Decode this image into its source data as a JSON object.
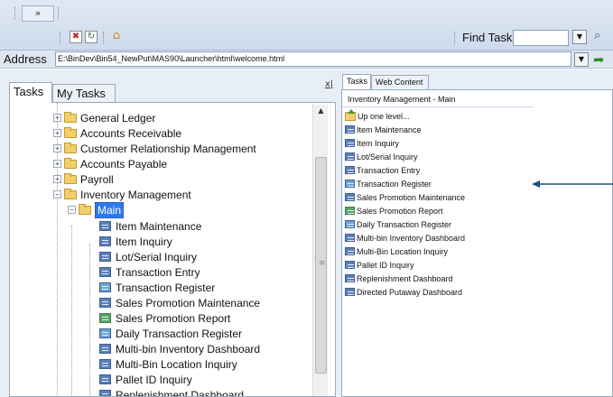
{
  "toolbar": {
    "chevron_label": "»",
    "find_task_label": "Find Task",
    "find_task_value": ""
  },
  "address": {
    "label": "Address",
    "url": "E:\\BinDev\\Bin54_NewPut\\MAS90\\Launcher\\html\\welcome.html"
  },
  "left_panel": {
    "tabs": [
      {
        "label": "Tasks"
      },
      {
        "label": "My Tasks"
      }
    ],
    "close_label": "x|",
    "tree": [
      {
        "label": "General Ledger",
        "kind": "folder",
        "expander": "+"
      },
      {
        "label": "Accounts Receivable",
        "kind": "folder",
        "expander": "+"
      },
      {
        "label": "Customer Relationship Management",
        "kind": "folder",
        "expander": "+"
      },
      {
        "label": "Accounts Payable",
        "kind": "folder",
        "expander": "+"
      },
      {
        "label": "Payroll",
        "kind": "folder",
        "expander": "+"
      },
      {
        "label": "Inventory Management",
        "kind": "folder",
        "expander": "−"
      },
      {
        "label": "Main",
        "kind": "folder-open",
        "expander": "−",
        "selected": true
      },
      {
        "label": "Item Maintenance",
        "kind": "task"
      },
      {
        "label": "Item Inquiry",
        "kind": "task"
      },
      {
        "label": "Lot/Serial Inquiry",
        "kind": "task"
      },
      {
        "label": "Transaction Entry",
        "kind": "task"
      },
      {
        "label": "Transaction Register",
        "kind": "report"
      },
      {
        "label": "Sales Promotion Maintenance",
        "kind": "task"
      },
      {
        "label": "Sales Promotion Report",
        "kind": "promo"
      },
      {
        "label": "Daily Transaction Register",
        "kind": "report"
      },
      {
        "label": "Multi-bin Inventory Dashboard",
        "kind": "task"
      },
      {
        "label": "Multi-Bin Location Inquiry",
        "kind": "task"
      },
      {
        "label": "Pallet ID Inquiry",
        "kind": "task"
      },
      {
        "label": "Replenishment Dashboard",
        "kind": "task"
      }
    ]
  },
  "right_panel": {
    "tabs": [
      {
        "label": "Tasks"
      },
      {
        "label": "Web Content"
      }
    ],
    "header": "Inventory Management - Main",
    "items": [
      {
        "label": "Up one level...",
        "kind": "up"
      },
      {
        "label": "Item Maintenance",
        "kind": "task"
      },
      {
        "label": "Item Inquiry",
        "kind": "task"
      },
      {
        "label": "Lot/Serial Inquiry",
        "kind": "task"
      },
      {
        "label": "Transaction Entry",
        "kind": "task"
      },
      {
        "label": "Transaction Register",
        "kind": "report"
      },
      {
        "label": "Sales Promotion Maintenance",
        "kind": "task"
      },
      {
        "label": "Sales Promotion Report",
        "kind": "promo"
      },
      {
        "label": "Daily Transaction Register",
        "kind": "report"
      },
      {
        "label": "Multi-bin Inventory Dashboard",
        "kind": "task"
      },
      {
        "label": "Multi-Bin Location Inquiry",
        "kind": "task"
      },
      {
        "label": "Pallet ID Inquiry",
        "kind": "task"
      },
      {
        "label": "Replenishment Dashboard",
        "kind": "task"
      },
      {
        "label": "Directed Putaway Dashboard",
        "kind": "task"
      }
    ]
  },
  "colors": {
    "accent": "#3079ed",
    "annotation_arrow": "#1f4e7a"
  }
}
